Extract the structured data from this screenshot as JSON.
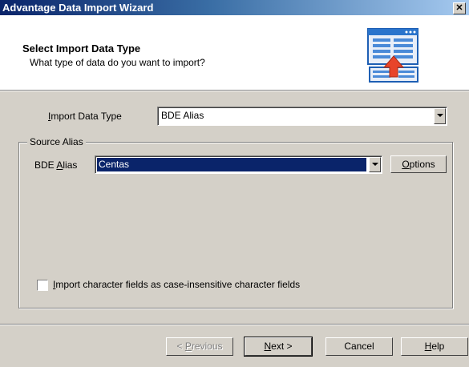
{
  "window": {
    "title": "Advantage Data Import Wizard",
    "close_glyph": "✕"
  },
  "header": {
    "title": "Select Import Data Type",
    "subtitle": "What type of data do you want to import?",
    "icon": "import-table-icon"
  },
  "form": {
    "import_type_label_pre": "",
    "import_type_label_u": "I",
    "import_type_label_post": "mport Data Type",
    "import_type_value": "BDE Alias",
    "group_title": "Source Alias",
    "alias_label_pre": "BDE ",
    "alias_label_u": "A",
    "alias_label_post": "lias",
    "alias_value": "Centas",
    "options_u": "O",
    "options_post": "ptions",
    "checkbox_u": "I",
    "checkbox_post": "mport character fields as case-insensitive character fields",
    "checkbox_checked": false
  },
  "buttons": {
    "previous_pre": "< ",
    "previous_u": "P",
    "previous_post": "revious",
    "next_u": "N",
    "next_post": "ext >",
    "cancel": "Cancel",
    "help_u": "H",
    "help_post": "elp"
  },
  "colors": {
    "title_bar": "#0a246a",
    "selection": "#0a246a",
    "dialog_bg": "#d4d0c8"
  }
}
